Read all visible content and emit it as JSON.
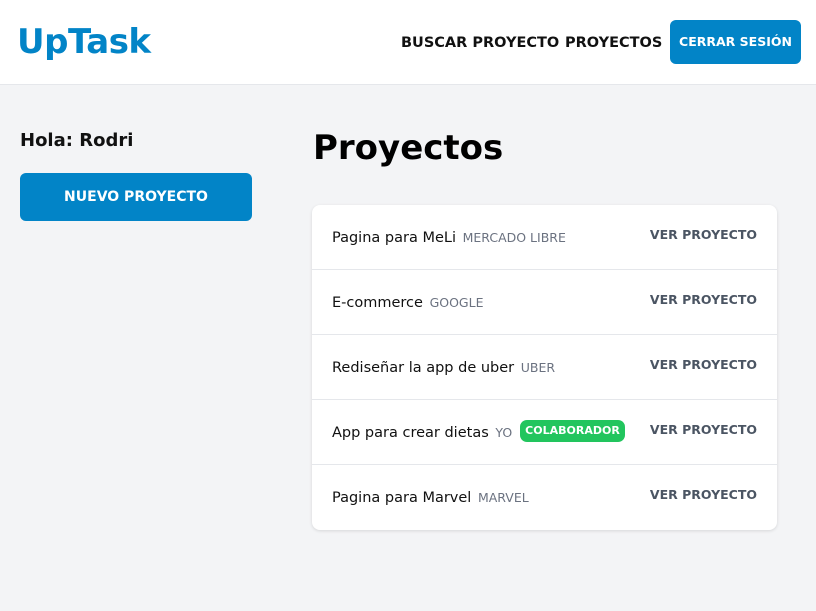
{
  "header": {
    "logo": "UpTask",
    "nav": {
      "search_label": "BUSCAR PROYECTO",
      "projects_label": "PROYECTOS"
    },
    "logout_label": "CERRAR SESIÓN"
  },
  "sidebar": {
    "greeting": "Hola: Rodri",
    "new_project_label": "NUEVO PROYECTO"
  },
  "main": {
    "title": "Proyectos",
    "projects": [
      {
        "name": "Pagina para MeLi",
        "client": "MERCADO LIBRE",
        "badge": "",
        "action": "VER PROYECTO"
      },
      {
        "name": "E-commerce",
        "client": "GOOGLE",
        "badge": "",
        "action": "VER PROYECTO"
      },
      {
        "name": "Rediseñar la app de uber",
        "client": "UBER",
        "badge": "",
        "action": "VER PROYECTO"
      },
      {
        "name": "App para crear dietas",
        "client": "YO",
        "badge": "COLABORADOR",
        "action": "VER PROYECTO"
      },
      {
        "name": "Pagina para Marvel",
        "client": "MARVEL",
        "badge": "",
        "action": "VER PROYECTO"
      }
    ]
  },
  "colors": {
    "brand": "#0284c7",
    "badge": "#22c55e",
    "background": "#f3f4f6"
  }
}
